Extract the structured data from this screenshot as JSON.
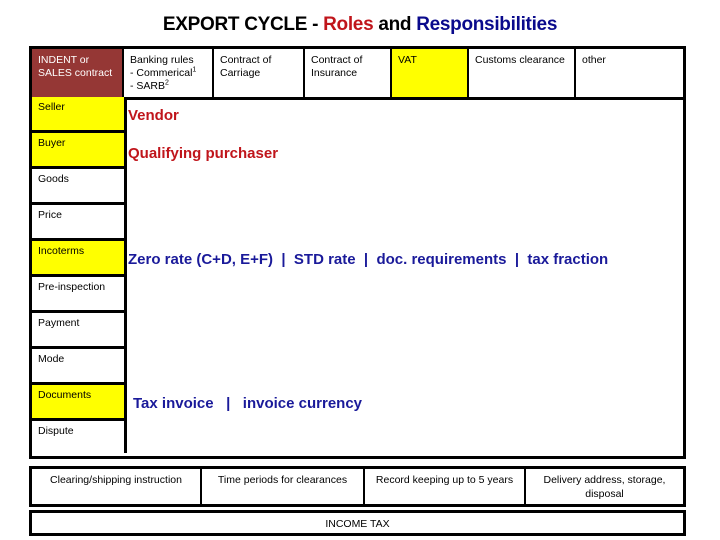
{
  "title": {
    "part1": "EXPORT CYCLE - ",
    "part2": "Roles",
    "part3": " and ",
    "part4": "Responsibilities"
  },
  "colors": {
    "brown": "#953735",
    "yellow": "#ffff00",
    "red_text": "#c0151b",
    "blue_text": "#1a1a9a"
  },
  "header": {
    "cells": [
      {
        "lines": [
          "INDENT or",
          "SALES contract"
        ],
        "style": "brown"
      },
      {
        "lines": [
          "Banking rules",
          "- Commerical",
          "- SARB"
        ],
        "superscripts": [
          "",
          "1",
          "2"
        ],
        "style": "white"
      },
      {
        "lines": [
          "Contract of",
          "Carriage"
        ],
        "style": "white"
      },
      {
        "lines": [
          "Contract of",
          "Insurance"
        ],
        "style": "white"
      },
      {
        "lines": [
          "VAT"
        ],
        "style": "yellow"
      },
      {
        "lines": [
          "Customs clearance"
        ],
        "style": "white"
      },
      {
        "lines": [
          "other"
        ],
        "style": "white"
      }
    ]
  },
  "rows": [
    {
      "label": "Seller",
      "style": "yellow",
      "content": "Vendor",
      "content_color": "red"
    },
    {
      "label": "Buyer",
      "style": "yellow",
      "content": "Qualifying purchaser",
      "content_color": "red"
    },
    {
      "label": "Goods",
      "style": "white"
    },
    {
      "label": "Price",
      "style": "white"
    },
    {
      "label": "Incoterms",
      "style": "yellow",
      "content": "Zero rate (C+D, E+F)  |  STD rate  |  doc. requirements  |  tax fraction",
      "content_color": "blue"
    },
    {
      "label": "Pre-inspection",
      "style": "white"
    },
    {
      "label": "Payment",
      "style": "white"
    },
    {
      "label": "Mode",
      "style": "white"
    },
    {
      "label": "Documents",
      "style": "yellow",
      "content": "Tax invoice   |   invoice currency",
      "content_color": "blue"
    },
    {
      "label": "Dispute",
      "style": "white"
    }
  ],
  "bottom": {
    "cells": [
      "Clearing/shipping instruction",
      "Time periods for clearances",
      "Record keeping up to 5 years",
      "Delivery address, storage, disposal"
    ],
    "income_tax": "INCOME TAX"
  }
}
